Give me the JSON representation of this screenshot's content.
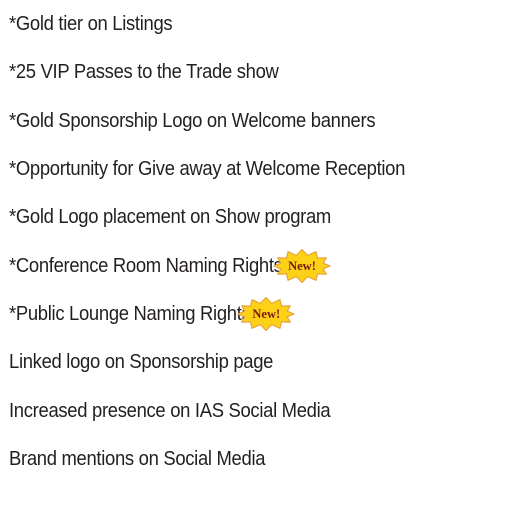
{
  "benefits": [
    {
      "text": "*Gold tier on Listings"
    },
    {
      "text": "*25 VIP Passes to the Trade show"
    },
    {
      "text": "*Gold Sponsorship Logo on Welcome banners"
    },
    {
      "text": "*Opportunity for Give away at Welcome Reception"
    },
    {
      "text": "*Gold Logo placement on Show program"
    },
    {
      "text": "*Conference Room Naming Rights",
      "badge": "New!"
    },
    {
      "text": "*Public Lounge Naming Rights",
      "badge": "New!"
    },
    {
      "text": "Linked logo on Sponsorship page"
    },
    {
      "text": "Increased presence on IAS Social Media"
    },
    {
      "text": "Brand mentions on Social Media"
    }
  ],
  "colors": {
    "text": "#231f20",
    "badge_fill": "#fcd116",
    "badge_outline": "#e8a33d",
    "badge_text": "#7a1a12"
  },
  "icons": {
    "badge_shape": "starburst-icon"
  }
}
